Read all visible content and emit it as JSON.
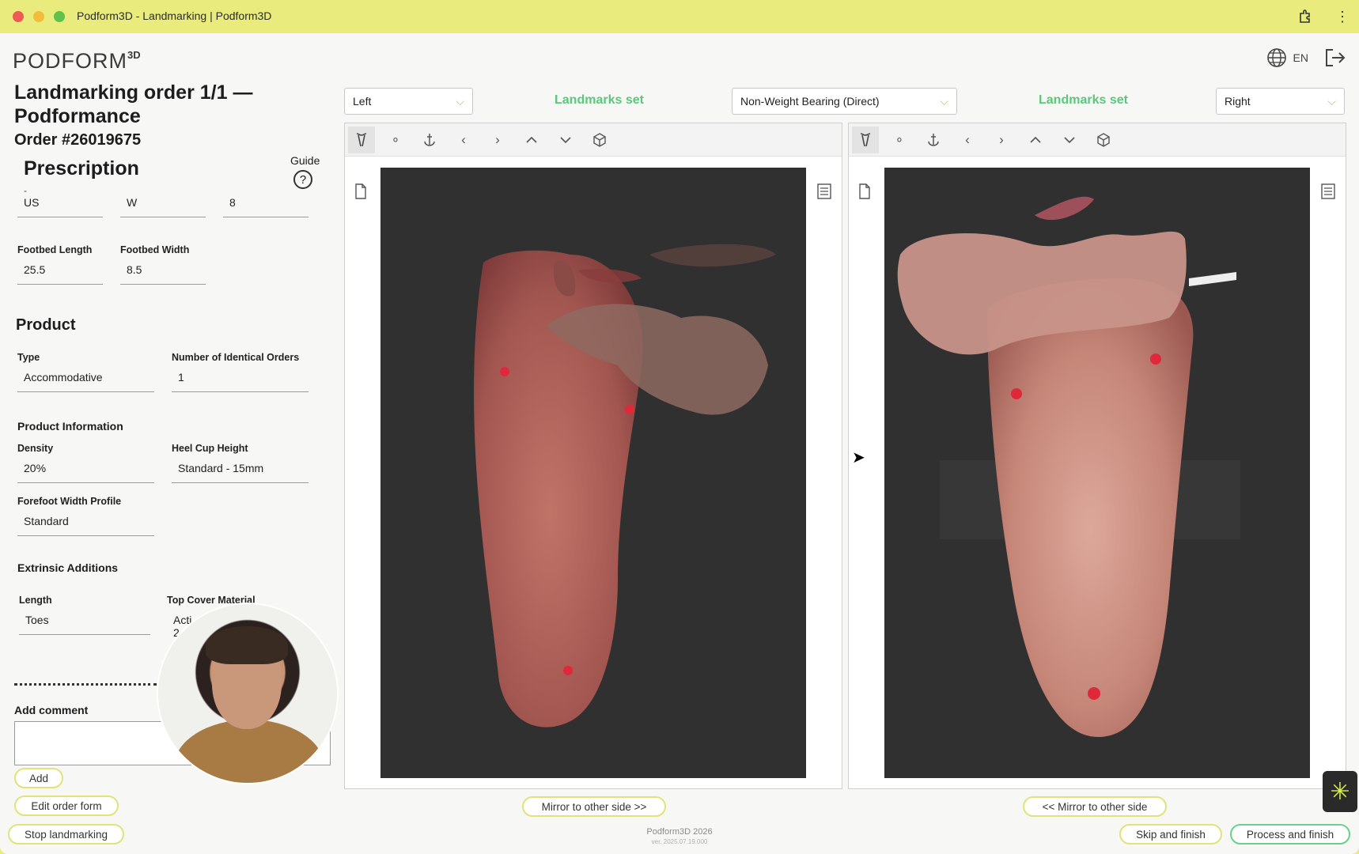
{
  "window": {
    "title": "Podform3D - Landmarking | Podform3D"
  },
  "header": {
    "logo": "PODFORM",
    "logo_sup": "3D",
    "language": "EN"
  },
  "order": {
    "title_line1": "Landmarking order 1/1 —",
    "title_line2": "Podformance",
    "number": "Order #26019675"
  },
  "prescription": {
    "title": "Prescription",
    "guide_label": "Guide",
    "stray_dash": "-",
    "size_system": "US",
    "gender": "W",
    "size": "8",
    "footbed_length_label": "Footbed Length",
    "footbed_length": "25.5",
    "footbed_width_label": "Footbed Width",
    "footbed_width": "8.5"
  },
  "product": {
    "title": "Product",
    "type_label": "Type",
    "type": "Accommodative",
    "identical_label": "Number of Identical Orders",
    "identical": "1",
    "info_title": "Product Information",
    "density_label": "Density",
    "density": "20%",
    "heel_label": "Heel Cup Height",
    "heel": "Standard - 15mm",
    "forefoot_label": "Forefoot Width Profile",
    "forefoot": "Standard",
    "extrinsic_title": "Extrinsic Additions",
    "length_label": "Length",
    "length": "Toes",
    "topcover_label": "Top Cover Material",
    "topcover": "Acti",
    "topcover_line2": "2"
  },
  "comment": {
    "label": "Add comment",
    "add_button": "Add"
  },
  "actions": {
    "edit_order": "Edit order form",
    "stop": "Stop landmarking",
    "mirror_right": "Mirror to other side >>",
    "mirror_left": "<< Mirror to other side",
    "skip": "Skip and finish",
    "process": "Process and finish"
  },
  "viewers": {
    "left_side": "Left",
    "right_side": "Right",
    "status_left": "Landmarks set",
    "status_right": "Landmarks set",
    "bearing": "Non-Weight Bearing (Direct)"
  },
  "footer": {
    "copyright": "Podform3D 2026",
    "version": "ver. 2025.07.19.000"
  },
  "colors": {
    "accent_green": "#5cc77c",
    "titlebar": "#e9ec7c",
    "landmark": "#e0283b"
  },
  "icons": [
    "landmark-tool-icon",
    "point-icon",
    "anchor-icon",
    "chevron-left-icon",
    "chevron-right-icon",
    "chevron-up-icon",
    "chevron-down-icon",
    "cube-icon",
    "document-icon",
    "list-icon",
    "globe-icon",
    "logout-icon",
    "help-icon"
  ]
}
